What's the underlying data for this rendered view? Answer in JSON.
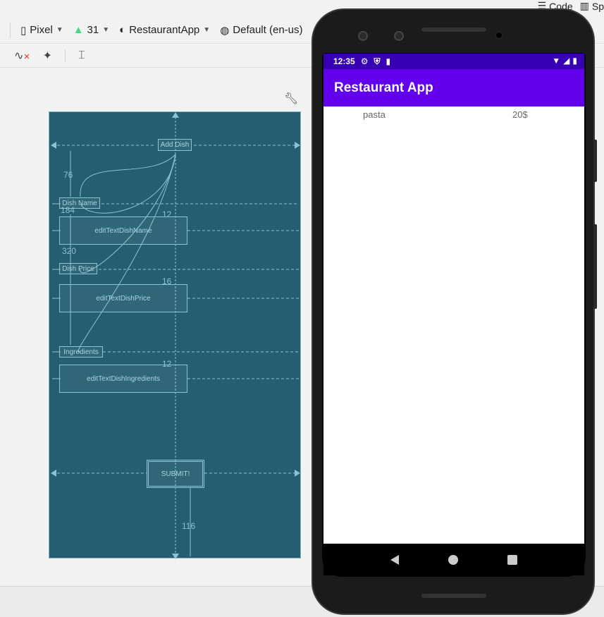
{
  "view_modes": {
    "code_label": "Code",
    "split_label": "Sp"
  },
  "toolbar": {
    "device": "Pixel",
    "api_level": "31",
    "theme": "RestaurantApp",
    "locale": "Default (en-us)"
  },
  "blueprint": {
    "add_dish_button": "Add Dish",
    "dish_name_label": "Dish Name",
    "dish_name_edit": "editTextDishName",
    "dish_price_label": "Dish Price",
    "dish_price_edit": "editTextDishPrice",
    "ingredients_label": "Ingredients",
    "ingredients_edit": "editTextDishIngredients",
    "submit_button": "SUBMIT!",
    "margins": {
      "m76": "76",
      "m184": "184",
      "m320": "320",
      "m12a": "12",
      "m16": "16",
      "m12b": "12",
      "m116": "116"
    }
  },
  "phone": {
    "status_time": "12:35",
    "app_title": "Restaurant App",
    "dishes": [
      {
        "name": "pasta",
        "price": "20$"
      }
    ]
  },
  "colors": {
    "primary": "#6200ee",
    "primary_dark": "#3700b3",
    "blueprint_bg": "#245e70"
  }
}
